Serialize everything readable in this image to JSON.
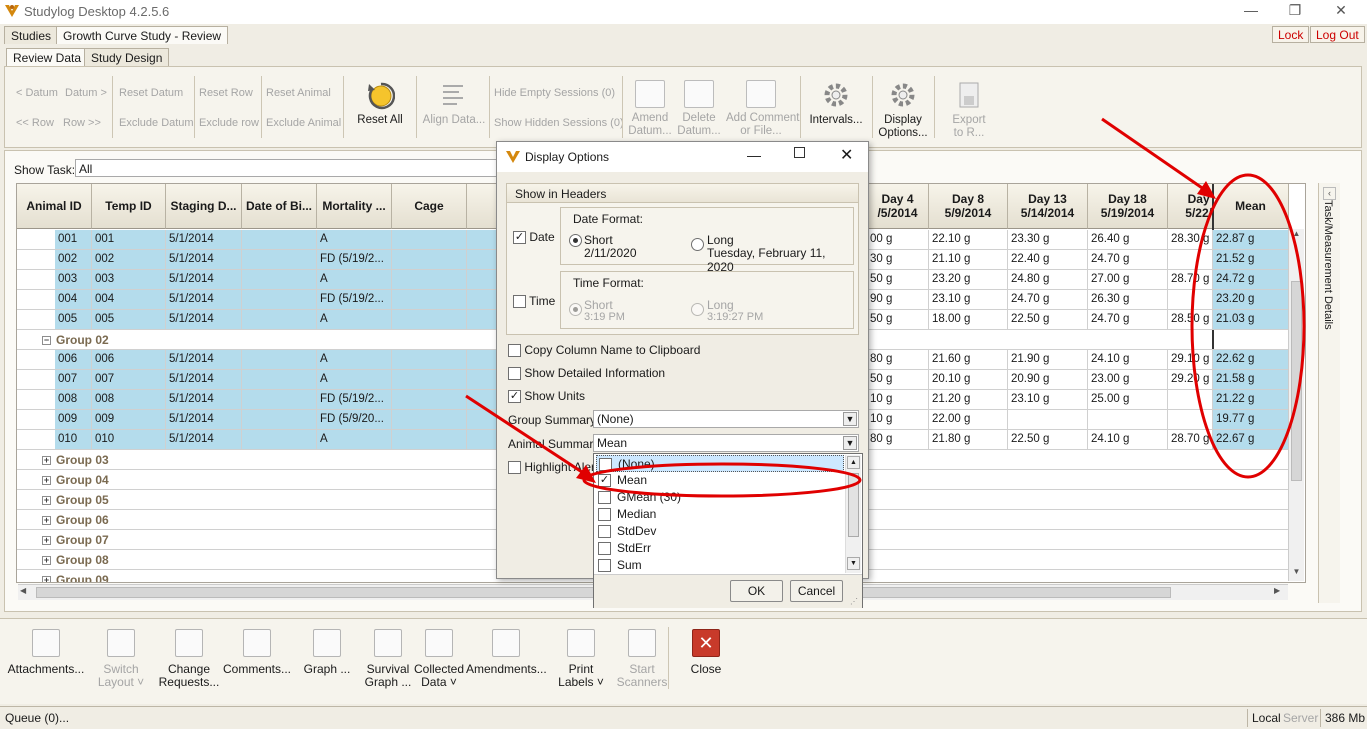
{
  "window": {
    "title": "Studylog Desktop 4.2.5.6",
    "minimize": "—",
    "restore": "❐",
    "close": "✕"
  },
  "top_tabs": [
    "Studies",
    "Growth Curve Study - Review"
  ],
  "top_buttons": {
    "lock": "Lock",
    "logout": "Log Out"
  },
  "sub_tabs": [
    "Review Data",
    "Study Design"
  ],
  "ribbon": {
    "prev_datum": "< Datum",
    "next_datum": "Datum >",
    "prev_row": "<< Row",
    "next_row": "Row >>",
    "reset_datum": "Reset Datum",
    "exclude_datum": "Exclude Datum",
    "reset_row": "Reset Row",
    "exclude_row": "Exclude row",
    "reset_animal": "Reset Animal",
    "exclude_animal": "Exclude Animal",
    "reset_all": "Reset All",
    "align_data": "Align Data...",
    "hide_empty": "Hide Empty Sessions (0)",
    "show_hidden": "Show Hidden Sessions (0)",
    "amend": [
      "Amend",
      "Datum..."
    ],
    "delete": [
      "Delete",
      "Datum..."
    ],
    "add_comment": [
      "Add Comment",
      "or File..."
    ],
    "intervals": "Intervals...",
    "display_options": [
      "Display",
      "Options..."
    ],
    "export": [
      "Export",
      "to R..."
    ]
  },
  "show_task": {
    "label": "Show Task:",
    "value": "All"
  },
  "grid": {
    "headers": [
      "Animal ID",
      "Temp ID",
      "Staging D...",
      "Date of Bi...",
      "Mortality ...",
      "Cage",
      "Co"
    ],
    "right_headers": [
      {
        "l1": "Day 4",
        "l2": "/5/2014"
      },
      {
        "l1": "Day 8",
        "l2": "5/9/2014"
      },
      {
        "l1": "Day 13",
        "l2": "5/14/2014"
      },
      {
        "l1": "Day 18",
        "l2": "5/19/2014"
      },
      {
        "l1": "Day",
        "l2": "5/22/"
      },
      {
        "l1": "Mean",
        "l2": ""
      }
    ],
    "rows": [
      {
        "id": "001",
        "temp": "001",
        "stage": "5/1/2014",
        "mort": "A",
        "d4": "00 g",
        "d8": "22.10 g",
        "d13": "23.30 g",
        "d18": "26.40 g",
        "d22": "28.30 g",
        "mean": "22.87 g"
      },
      {
        "id": "002",
        "temp": "002",
        "stage": "5/1/2014",
        "mort": "FD  (5/19/2...",
        "d4": "30 g",
        "d8": "21.10 g",
        "d13": "22.40 g",
        "d18": "24.70 g",
        "d22": "",
        "mean": "21.52 g"
      },
      {
        "id": "003",
        "temp": "003",
        "stage": "5/1/2014",
        "mort": "A",
        "d4": "50 g",
        "d8": "23.20 g",
        "d13": "24.80 g",
        "d18": "27.00 g",
        "d22": "28.70 g",
        "mean": "24.72 g"
      },
      {
        "id": "004",
        "temp": "004",
        "stage": "5/1/2014",
        "mort": "FD  (5/19/2...",
        "d4": "90 g",
        "d8": "23.10 g",
        "d13": "24.70 g",
        "d18": "26.30 g",
        "d22": "",
        "mean": "23.20 g"
      },
      {
        "id": "005",
        "temp": "005",
        "stage": "5/1/2014",
        "mort": "A",
        "d4": "50 g",
        "d8": "18.00 g",
        "d13": "22.50 g",
        "d18": "24.70 g",
        "d22": "28.50 g",
        "mean": "21.03 g"
      },
      {
        "group": "Group 02",
        "expanded": true
      },
      {
        "id": "006",
        "temp": "006",
        "stage": "5/1/2014",
        "mort": "A",
        "d4": "80 g",
        "d8": "21.60 g",
        "d13": "21.90 g",
        "d18": "24.10 g",
        "d22": "29.10 g",
        "mean": "22.62 g"
      },
      {
        "id": "007",
        "temp": "007",
        "stage": "5/1/2014",
        "mort": "A",
        "d4": "50 g",
        "d8": "20.10 g",
        "d13": "20.90 g",
        "d18": "23.00 g",
        "d22": "29.20 g",
        "mean": "21.58 g"
      },
      {
        "id": "008",
        "temp": "008",
        "stage": "5/1/2014",
        "mort": "FD  (5/19/2...",
        "d4": "10 g",
        "d8": "21.20 g",
        "d13": "23.10 g",
        "d18": "25.00 g",
        "d22": "",
        "mean": "21.22 g"
      },
      {
        "id": "009",
        "temp": "009",
        "stage": "5/1/2014",
        "mort": "FD  (5/9/20...",
        "d4": "10 g",
        "d8": "22.00 g",
        "d13": "",
        "d18": "",
        "d22": "",
        "mean": "19.77 g"
      },
      {
        "id": "010",
        "temp": "010",
        "stage": "5/1/2014",
        "mort": "A",
        "d4": "80 g",
        "d8": "21.80 g",
        "d13": "22.50 g",
        "d18": "24.10 g",
        "d22": "28.70 g",
        "mean": "22.67 g"
      },
      {
        "group": "Group 03"
      },
      {
        "group": "Group 04"
      },
      {
        "group": "Group 05"
      },
      {
        "group": "Group 06"
      },
      {
        "group": "Group 07"
      },
      {
        "group": "Group 08"
      },
      {
        "group": "Group 09"
      }
    ]
  },
  "side_panel": {
    "label": "Task/Measurement Details"
  },
  "bottom": [
    {
      "l1": "Attachments...",
      "l2": "",
      "dis": false
    },
    {
      "l1": "Switch",
      "l2": "Layout ˅",
      "dis": true
    },
    {
      "l1": "Change",
      "l2": "Requests...",
      "dis": false
    },
    {
      "l1": "Comments...",
      "l2": "",
      "dis": false
    },
    {
      "l1": "Graph ...",
      "l2": "",
      "dis": false
    },
    {
      "l1": "Survival",
      "l2": "Graph ...",
      "dis": false
    },
    {
      "l1": "Collected",
      "l2": "Data ˅",
      "dis": false
    },
    {
      "l1": "Amendments...",
      "l2": "",
      "dis": false
    },
    {
      "l1": "Print",
      "l2": "Labels ˅",
      "dis": false
    },
    {
      "l1": "Start",
      "l2": "Scanners",
      "dis": true
    },
    {
      "l1": "Close",
      "l2": "",
      "dis": false
    }
  ],
  "status": {
    "queue": "Queue (0)...",
    "local": "Local",
    "server": "Server",
    "mem": "386 Mb"
  },
  "dialog": {
    "title": "Display Options",
    "show_in_headers": "Show in Headers",
    "date_label": "Date",
    "date_format": "Date Format:",
    "short": "Short",
    "short_ex": "2/11/2020",
    "long": "Long",
    "long_ex": "Tuesday, February 11, 2020",
    "time_label": "Time",
    "time_format": "Time Format:",
    "t_short": "Short",
    "t_short_ex": "3:19 PM",
    "t_long": "Long",
    "t_long_ex": "3:19:27 PM",
    "copy_col": "Copy Column Name to Clipboard",
    "detailed": "Show Detailed Information",
    "units": "Show Units",
    "group_summary_label": "Group Summary:",
    "group_summary_value": "(None)",
    "animal_summary_label": "Animal Summary:",
    "animal_summary_value": "Mean",
    "highlight": "Highlight Alerts",
    "ok": "OK",
    "cancel": "Cancel"
  },
  "dropdown": {
    "items": [
      {
        "label": "(None)",
        "checked": false,
        "hi": true
      },
      {
        "label": "Mean",
        "checked": true,
        "hi": false
      },
      {
        "label": "GMean (30)",
        "checked": false,
        "hi": false
      },
      {
        "label": "Median",
        "checked": false,
        "hi": false
      },
      {
        "label": "StdDev",
        "checked": false,
        "hi": false
      },
      {
        "label": "StdErr",
        "checked": false,
        "hi": false
      },
      {
        "label": "Sum",
        "checked": false,
        "hi": false
      }
    ]
  },
  "colors": {
    "selected_row": "#b4dcec",
    "annotation": "#e00000",
    "accent": "#d4880e"
  }
}
